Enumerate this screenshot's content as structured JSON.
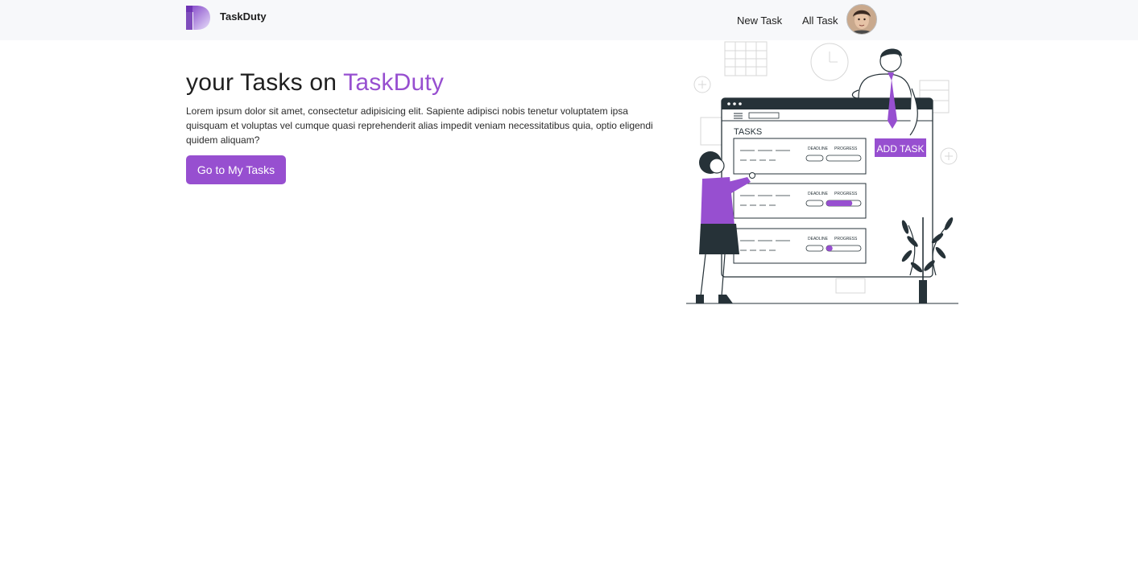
{
  "navbar": {
    "brand_name": "TaskDuty",
    "links": [
      {
        "label": "New Task"
      },
      {
        "label": "All Task"
      }
    ]
  },
  "hero": {
    "title_prefix": "your Tasks on ",
    "title_accent": "TaskDuty",
    "description": "Lorem ipsum dolor sit amet, consectetur adipisicing elit. Sapiente adipisci nobis tenetur voluptatem ipsa quisquam et voluptas vel cumque quasi reprehenderit alias impedit veniam necessitatibus quia, optio eligendi quidem aliquam?",
    "cta_label": "Go to My Tasks"
  },
  "illustration": {
    "heading": "TASKS",
    "add_button": "ADD TASK",
    "deadline_label": "DEADLINE",
    "progress_label": "PROGRESS",
    "task_progress": [
      0,
      0.75,
      0.18
    ]
  },
  "colors": {
    "accent": "#974fd0",
    "navbar_bg": "#f7f8fa",
    "text": "#1f1f1f"
  }
}
